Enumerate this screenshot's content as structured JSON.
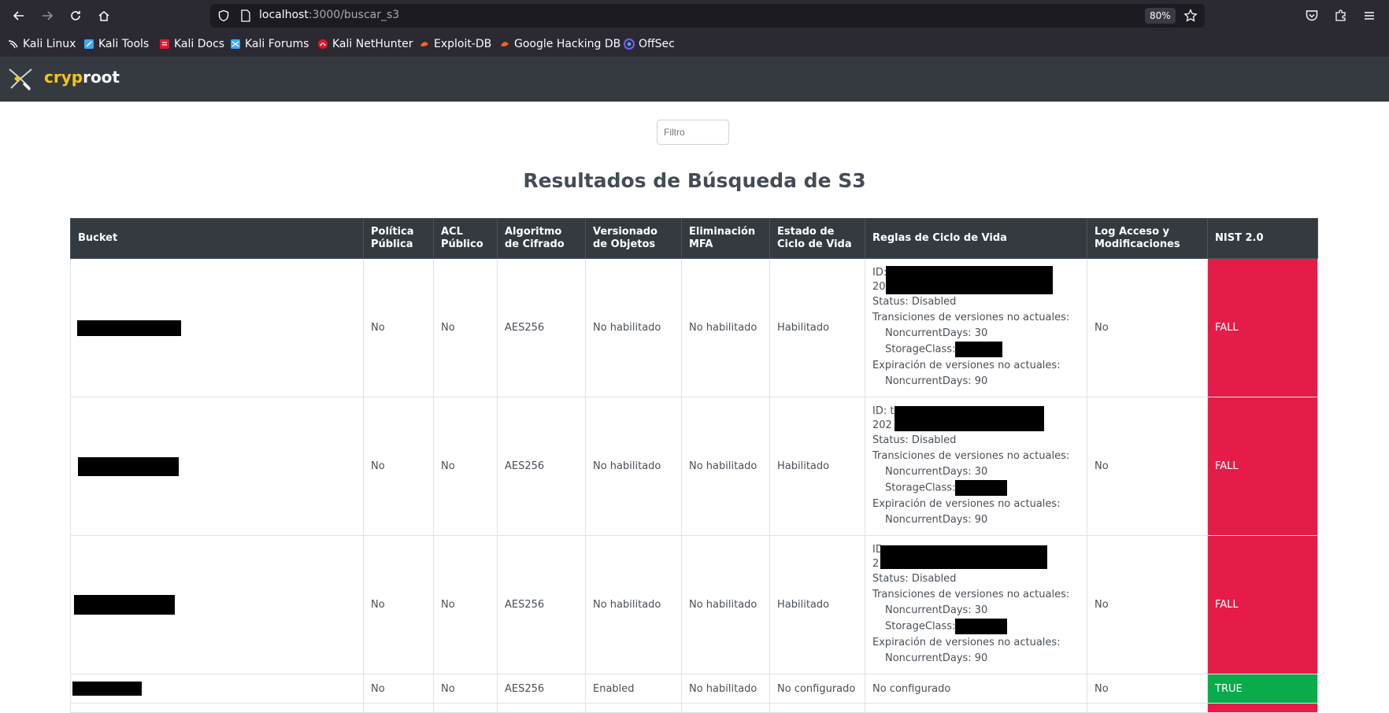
{
  "browser": {
    "url_host": "localhost",
    "url_path": ":3000/buscar_s3",
    "zoom": "80%",
    "bookmarks": [
      {
        "label": "Kali Linux",
        "icon": "kali-dragon-icon",
        "color": "#ffffff"
      },
      {
        "label": "Kali Tools",
        "icon": "kali-tools-icon",
        "color": "#3fa9f5"
      },
      {
        "label": "Kali Docs",
        "icon": "kali-docs-icon",
        "color": "#e0182d"
      },
      {
        "label": "Kali Forums",
        "icon": "kali-forums-icon",
        "color": "#3fa9f5"
      },
      {
        "label": "Kali NetHunter",
        "icon": "nethunter-icon",
        "color": "#e0182d"
      },
      {
        "label": "Exploit-DB",
        "icon": "exploit-db-icon",
        "color": "#f26522"
      },
      {
        "label": "Google Hacking DB",
        "icon": "ghdb-icon",
        "color": "#f26522"
      },
      {
        "label": "OffSec",
        "icon": "offsec-icon",
        "color": "#7b5cff"
      }
    ]
  },
  "app": {
    "brand_part1": "cryp",
    "brand_part2": "root",
    "brand_accent": "#f5c518"
  },
  "page": {
    "filter_placeholder": "Filtro",
    "title": "Resultados de Búsqueda de S3"
  },
  "table": {
    "headers": [
      "Bucket",
      "Política Pública",
      "ACL Público",
      "Algoritmo de Cifrado",
      "Versionado de Objetos",
      "Eliminación MFA",
      "Estado de Ciclo de Vida",
      "Reglas de Ciclo de Vida",
      "Log Acceso y Modificaciones",
      "NIST 2.0"
    ],
    "rows": [
      {
        "politica": "No",
        "acl": "No",
        "algoritmo": "AES256",
        "versionado": "No habilitado",
        "mfa": "No habilitado",
        "estado": "Habilitado",
        "rule_id_label": "ID:",
        "rule_id_prefix": "20",
        "status": "Status: Disabled",
        "transiciones": "Transiciones de versiones no actuales:",
        "nc_days_trans": "NoncurrentDays: 30",
        "storage_label": "StorageClass:",
        "expiracion": "Expiración de versiones no actuales:",
        "nc_days_exp": "NoncurrentDays: 90",
        "log": "No",
        "nist": "FALL"
      },
      {
        "politica": "No",
        "acl": "No",
        "algoritmo": "AES256",
        "versionado": "No habilitado",
        "mfa": "No habilitado",
        "estado": "Habilitado",
        "rule_id_label": "ID: t",
        "rule_id_prefix": "202",
        "status": "Status: Disabled",
        "transiciones": "Transiciones de versiones no actuales:",
        "nc_days_trans": "NoncurrentDays: 30",
        "storage_label": "StorageClass:",
        "expiracion": "Expiración de versiones no actuales:",
        "nc_days_exp": "NoncurrentDays: 90",
        "log": "No",
        "nist": "FALL"
      },
      {
        "politica": "No",
        "acl": "No",
        "algoritmo": "AES256",
        "versionado": "No habilitado",
        "mfa": "No habilitado",
        "estado": "Habilitado",
        "rule_id_label": "ID",
        "rule_id_prefix": "2",
        "status": "Status: Disabled",
        "transiciones": "Transiciones de versiones no actuales:",
        "nc_days_trans": "NoncurrentDays: 30",
        "storage_label": "StorageClass:",
        "expiracion": "Expiración de versiones no actuales:",
        "nc_days_exp": "NoncurrentDays: 90",
        "log": "No",
        "nist": "FALL"
      },
      {
        "politica": "No",
        "acl": "No",
        "algoritmo": "AES256",
        "versionado": "Enabled",
        "mfa": "No habilitado",
        "estado": "No configurado",
        "reglas": "No configurado",
        "log": "No",
        "nist": "TRUE"
      }
    ]
  },
  "colors": {
    "fail": "#e51c48",
    "true": "#0aab4a",
    "header_bg": "#343a40"
  }
}
